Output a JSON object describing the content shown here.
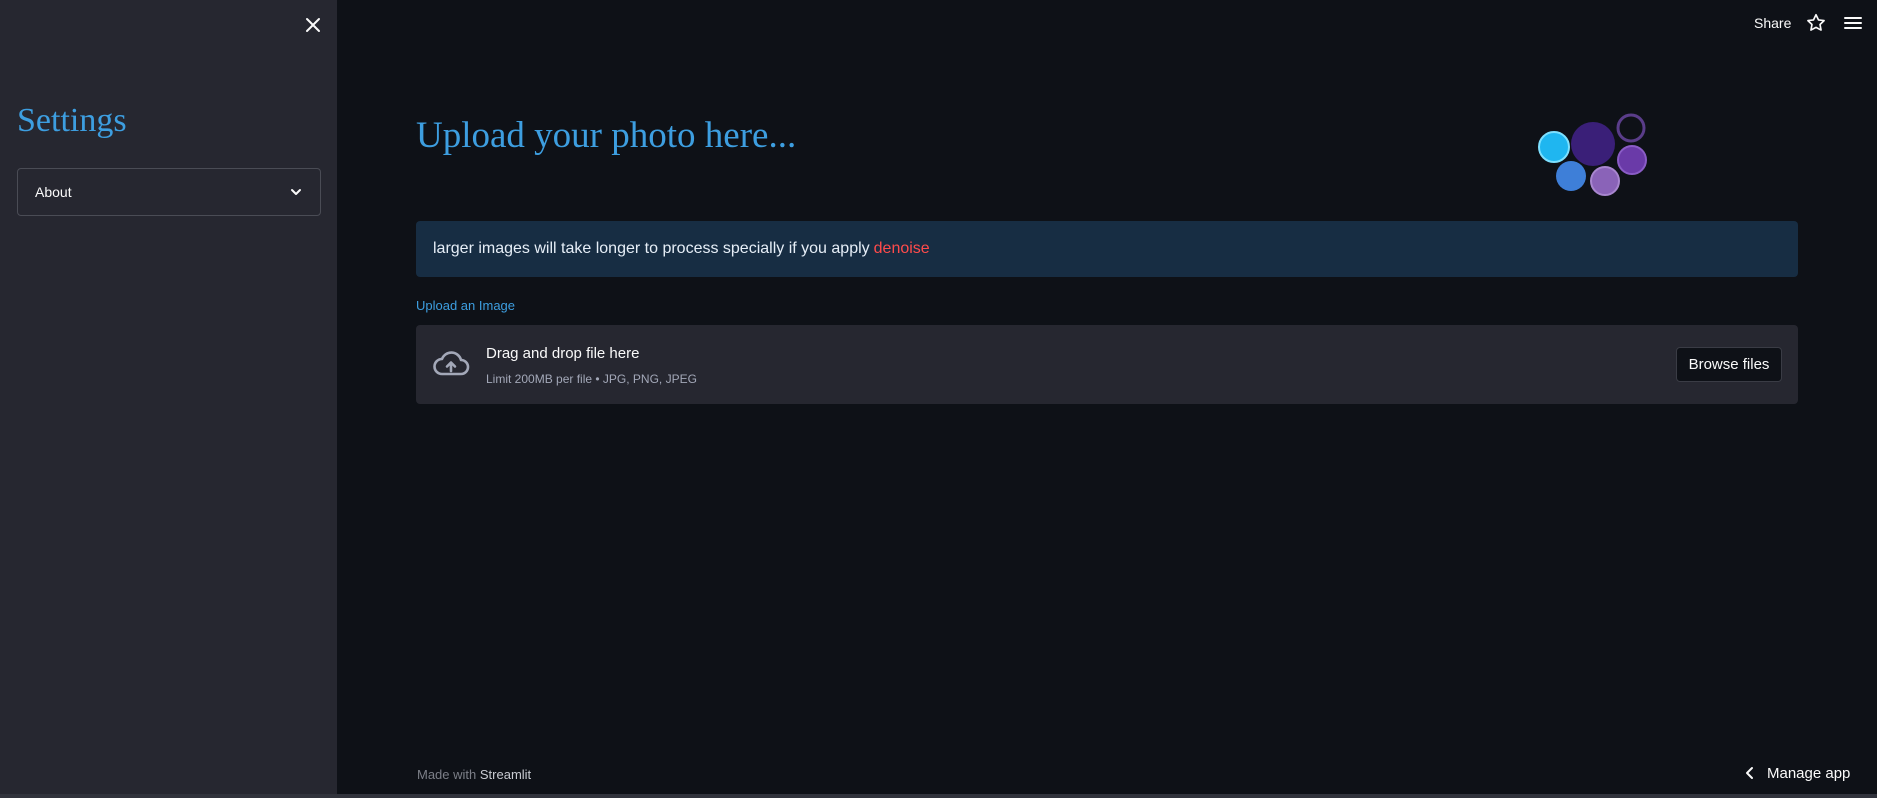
{
  "sidebar": {
    "title": "Settings",
    "expander": {
      "label": "About"
    },
    "close_icon": "close-icon"
  },
  "topbar": {
    "share_label": "Share",
    "star_icon": "star-icon",
    "menu_icon": "hamburger-menu-icon"
  },
  "main": {
    "title": "Upload your photo here...",
    "info": {
      "text": "larger images will take longer to process specially if you apply",
      "accent": "denoise"
    },
    "uploader": {
      "label": "Upload an Image",
      "drop_title": "Drag and drop file here",
      "drop_sub": "Limit 200MB per file • JPG, PNG, JPEG",
      "browse_label": "Browse files"
    }
  },
  "footer": {
    "made_with": "Made with",
    "brand": "Streamlit",
    "manage_app": "Manage app"
  },
  "colors": {
    "background": "#0e1117",
    "sidebar": "#262730",
    "accent_blue": "#3d9ee0",
    "accent_red": "#ff4b4b",
    "info_bg": "#172d43"
  }
}
